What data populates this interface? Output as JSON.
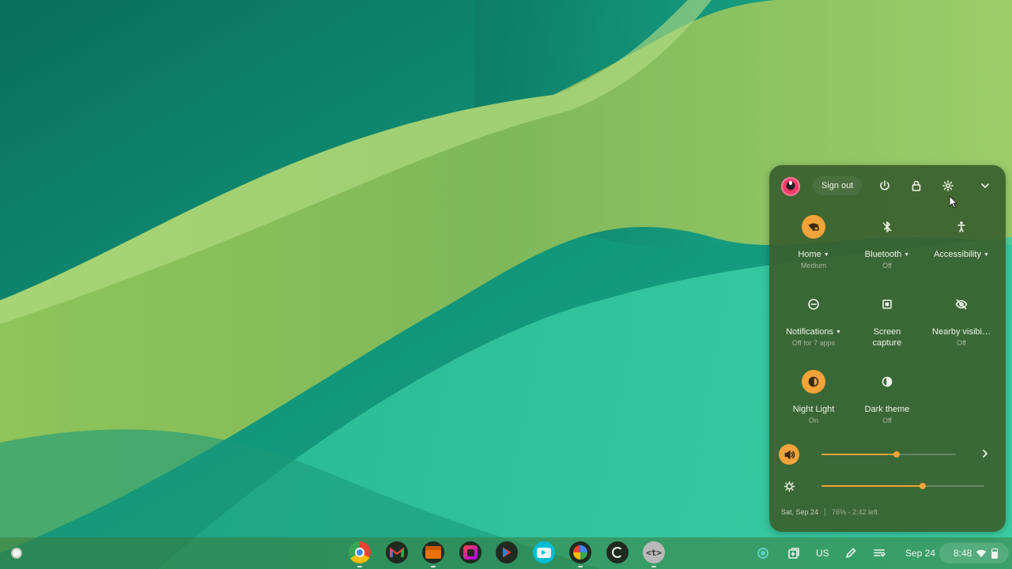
{
  "quick_settings": {
    "sign_out_label": "Sign out",
    "icons": {
      "power": "power-icon",
      "lock": "lock-icon",
      "settings": "gear-icon",
      "collapse": "chevron-down-icon"
    },
    "tiles": [
      {
        "label": "Home",
        "sublabel": "Medium",
        "has_menu": true,
        "on": true,
        "icon": "wifi-icon"
      },
      {
        "label": "Bluetooth",
        "sublabel": "Off",
        "has_menu": true,
        "on": false,
        "icon": "bluetooth-icon"
      },
      {
        "label": "Accessibility",
        "sublabel": "",
        "has_menu": true,
        "on": false,
        "icon": "accessibility-icon"
      },
      {
        "label": "Notifications",
        "sublabel": "Off for 7 apps",
        "has_menu": true,
        "on": false,
        "icon": "do-not-disturb-icon"
      },
      {
        "label": "Screen",
        "label2": "capture",
        "sublabel": "",
        "has_menu": false,
        "on": false,
        "icon": "screen-capture-icon"
      },
      {
        "label": "Nearby visibi…",
        "sublabel": "Off",
        "has_menu": false,
        "on": false,
        "icon": "visibility-off-icon"
      },
      {
        "label": "Night Light",
        "sublabel": "On",
        "has_menu": false,
        "on": true,
        "icon": "night-light-icon"
      },
      {
        "label": "Dark theme",
        "sublabel": "Off",
        "has_menu": false,
        "on": false,
        "icon": "dark-theme-icon"
      }
    ],
    "volume": {
      "level": 0.56,
      "icon": "volume-icon"
    },
    "brightness": {
      "level": 0.62,
      "icon": "brightness-icon"
    },
    "footer": {
      "date": "Sat, Sep 24",
      "battery": "76% - 2:42 left"
    }
  },
  "shelf": {
    "apps": [
      {
        "name": "chrome",
        "icon": "chrome-icon",
        "color": "#e8453c"
      },
      {
        "name": "gmail",
        "icon": "gmail-icon",
        "color": "#202124"
      },
      {
        "name": "files",
        "icon": "files-icon",
        "color": "#e8710a"
      },
      {
        "name": "screencast",
        "icon": "screencast-icon",
        "color": "#202124"
      },
      {
        "name": "play-store",
        "icon": "play-store-icon",
        "color": "#202124"
      },
      {
        "name": "youtube",
        "icon": "youtube-icon",
        "color": "#00bcd4"
      },
      {
        "name": "photos",
        "icon": "photos-icon",
        "color": "#202124"
      },
      {
        "name": "app-dark",
        "icon": "app-icon",
        "color": "#202124"
      },
      {
        "name": "terminal",
        "icon": "terminal-icon",
        "color": "#b7b7b7"
      }
    ],
    "tray": {
      "keyboard_layout": "US",
      "date": "Sep 24",
      "time": "8:48"
    }
  }
}
